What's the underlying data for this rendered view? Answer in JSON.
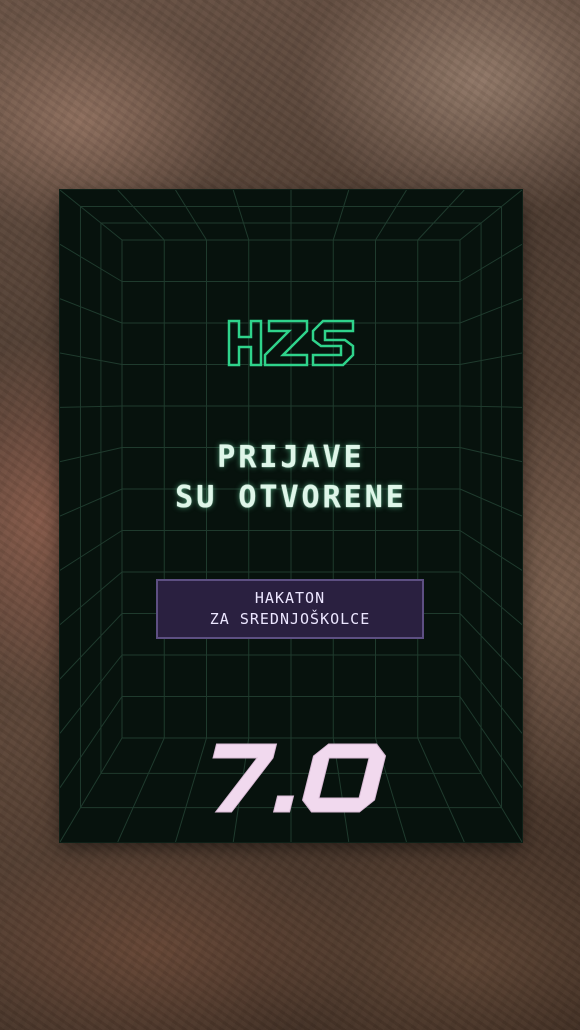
{
  "poster": {
    "logo_text": "HZS",
    "headline_line1": "PRIJAVE",
    "headline_line2": "SU OTVORENE",
    "tag_line1": "HAKATON",
    "tag_line2": "ZA SREDNJOŠKOLCE",
    "version": "7.0"
  },
  "colors": {
    "poster_bg": "#07120d",
    "grid_line": "#1f3a2d",
    "logo_green": "#2fd38b",
    "headline_glow": "#dff6e9",
    "tag_bg": "#2a2040",
    "tag_border": "#5d4f82",
    "version_fill": "#f1d9ee"
  }
}
